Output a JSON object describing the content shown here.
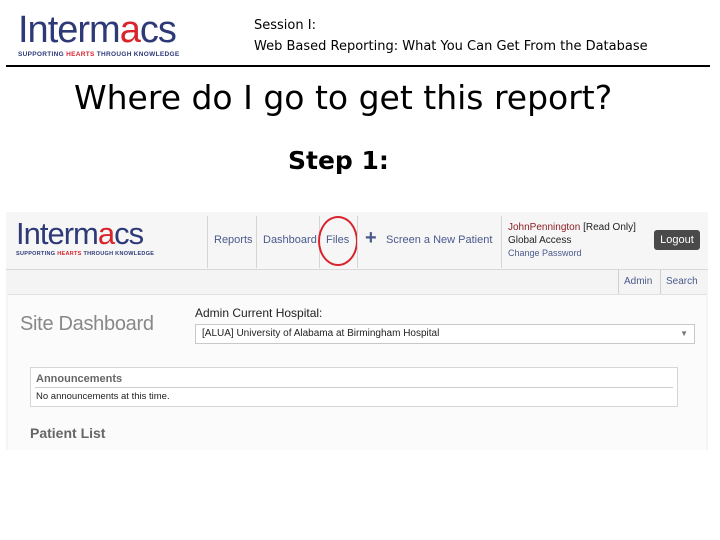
{
  "slide": {
    "logo": {
      "word_before": "Interm",
      "word_arc": "a",
      "word_after": "cs",
      "tag_before": "SUPPORTING ",
      "tag_highlight": "HEARTS",
      "tag_after": " THROUGH KNOWLEDGE"
    },
    "session_line1": "Session I:",
    "session_line2": "Web Based Reporting: What You Can Get From the Database",
    "title": "Where do I go to get this report?",
    "step": "Step 1:"
  },
  "app": {
    "logo": {
      "word_before": "Interm",
      "word_arc": "a",
      "word_after": "cs",
      "tag_before": "SUPPORTING ",
      "tag_highlight": "HEARTS",
      "tag_after": " THROUGH KNOWLEDGE"
    },
    "nav": {
      "reports": "Reports",
      "dashboard": "Dashboard",
      "files": "Files",
      "plus": "+",
      "screen_new_patient": "Screen a New Patient"
    },
    "user": {
      "name": "JohnPennington",
      "role": "[Read Only]",
      "access": "Global Access",
      "change_password": "Change Password",
      "logout": "Logout"
    },
    "admin_bar": {
      "admin": "Admin",
      "search": "Search"
    },
    "dashboard": {
      "title": "Site Dashboard",
      "hospital_label": "Admin Current Hospital:",
      "hospital_value": "[ALUA] University of Alabama at Birmingham Hospital",
      "hospital_caret": "▼",
      "announcements_title": "Announcements",
      "announcements_text": "No announcements at this time.",
      "patient_list": "Patient List"
    },
    "highlight_color": "#d9232d"
  }
}
